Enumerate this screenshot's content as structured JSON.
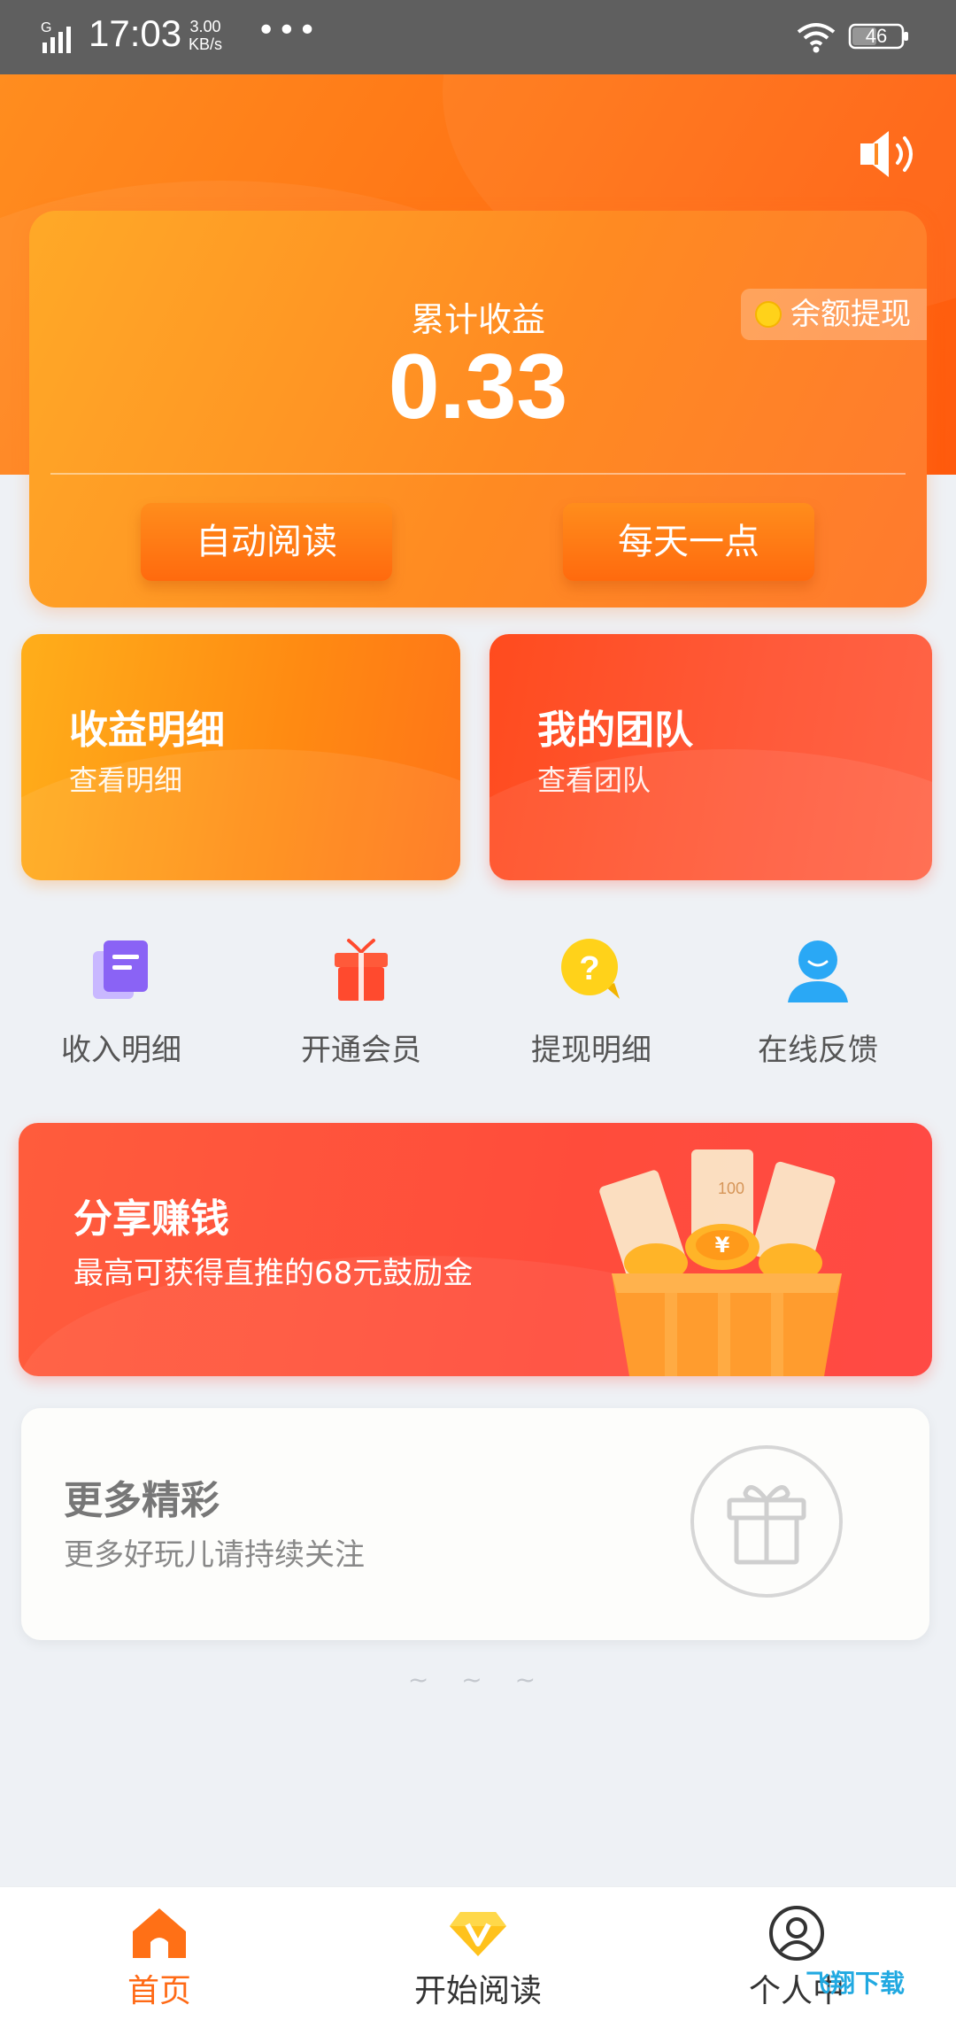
{
  "status_bar": {
    "time": "17:03",
    "network_type": "G",
    "speed_value": "3.00",
    "speed_unit": "KB/s",
    "more_dots": "•••",
    "battery": "46"
  },
  "earnings": {
    "title": "累计收益",
    "amount": "0.33",
    "withdraw_label": "余额提现",
    "auto_read_label": "自动阅读",
    "daily_label": "每天一点"
  },
  "features": [
    {
      "title": "收益明细",
      "subtitle": "查看明细"
    },
    {
      "title": "我的团队",
      "subtitle": "查看团队"
    }
  ],
  "shortcuts": [
    {
      "label": "收入明细",
      "icon": "document-icon"
    },
    {
      "label": "开通会员",
      "icon": "gift-box-icon"
    },
    {
      "label": "提现明细",
      "icon": "question-bubble-icon"
    },
    {
      "label": "在线反馈",
      "icon": "user-service-icon"
    }
  ],
  "share_banner": {
    "title": "分享赚钱",
    "subtitle": "最高可获得直推的68元鼓励金"
  },
  "more": {
    "title": "更多精彩",
    "subtitle": "更多好玩儿请持续关注"
  },
  "footer_tilde": "~ ~ ~",
  "bottom_nav": [
    {
      "label": "首页",
      "icon": "home-icon",
      "active": true
    },
    {
      "label": "开始阅读",
      "icon": "diamond-v-icon",
      "active": false
    },
    {
      "label": "个人中",
      "icon": "user-circle-icon",
      "active": false
    }
  ],
  "watermark": "飞翔下载",
  "colors": {
    "accent_orange": "#ff7616",
    "team_red": "#ff5a3a",
    "background": "#eef1f5"
  }
}
